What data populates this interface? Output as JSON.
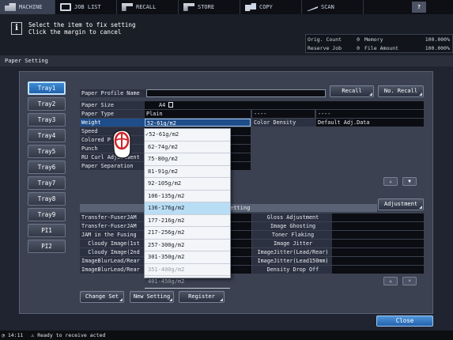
{
  "topbar": {
    "tabs": [
      {
        "label": "MACHINE",
        "icon": "machine-icon"
      },
      {
        "label": "JOB LIST",
        "icon": "job-list-icon"
      },
      {
        "label": "RECALL",
        "icon": "recall-icon"
      },
      {
        "label": "STORE",
        "icon": "store-icon"
      },
      {
        "label": "COPY",
        "icon": "copy-icon"
      },
      {
        "label": "SCAN",
        "icon": "scan-icon"
      }
    ],
    "help": "?"
  },
  "message": {
    "line1": "Select the item to fix setting",
    "line2": "Click the margin to cancel"
  },
  "status": {
    "orig_count_label": "Orig. Count",
    "orig_count_value": "0",
    "memory_label": "Memory",
    "memory_value": "100.000%",
    "reserve_job_label": "Reserve Job",
    "reserve_job_value": "0",
    "file_amount_label": "File Amount",
    "file_amount_value": "100.000%"
  },
  "screen_title": "Paper Setting",
  "trays": [
    "Tray1",
    "Tray2",
    "Tray3",
    "Tray4",
    "Tray5",
    "Tray6",
    "Tray7",
    "Tray8",
    "Tray9",
    "PI1",
    "PI2"
  ],
  "profile": {
    "label": "Paper Profile Name",
    "recall_button": "Recall",
    "no_recall_button": "No. Recall"
  },
  "settings": {
    "paper_size_label": "Paper Size",
    "paper_size_value": "A4",
    "paper_type_label": "Paper Type",
    "paper_type_value": "Plain",
    "weight_label": "Weight",
    "weight_value": "52-61g/m2",
    "speed_label": "Speed",
    "colored_label": "Colored P",
    "punch_label": "Punch",
    "ru_curl_label": "RU Curl Adjustment",
    "separation_label": "Paper Separation",
    "dash1": "----",
    "dash2": "----",
    "color_density_label": "Color Density",
    "color_density_value": "Default Adj.Data"
  },
  "adjustment": {
    "section_title": "etting",
    "button": "Adjustment",
    "left_items": [
      "Transfer-FuserJAM",
      "Transfer-FuserJAM",
      "JAM in the Fusing",
      "Cloudy Image(1st",
      "Cloudy Image(2nd",
      "ImageBlurLead/Rear",
      "ImageBlurLead/Rear"
    ],
    "right_items": [
      "Gloss Adjustment",
      "Image Ghosting",
      "Toner Flaking",
      "Image Jitter",
      "ImageJitter(Lead/Rear)",
      "ImageJitter(Lead150mm)",
      "Density Drop Off"
    ]
  },
  "dropdown": {
    "options": [
      "52-61g/m2",
      "62-74g/m2",
      "75-80g/m2",
      "81-91g/m2",
      "92-105g/m2",
      "106-135g/m2",
      "136-176g/m2",
      "177-216g/m2",
      "217-256g/m2",
      "257-300g/m2",
      "301-350g/m2",
      "351-400g/m2",
      "401-450g/m2"
    ],
    "checked_index": 0,
    "highlight_index": 6,
    "disabled_from_index": 11
  },
  "scroll": {
    "up": "▲",
    "down": "▼"
  },
  "bottom_buttons": {
    "change_set": "Change Set",
    "new_setting": "New Setting",
    "register": "Register"
  },
  "close_button": "Close",
  "footer": {
    "time": "14:11",
    "status": "Ready to receive acted"
  }
}
